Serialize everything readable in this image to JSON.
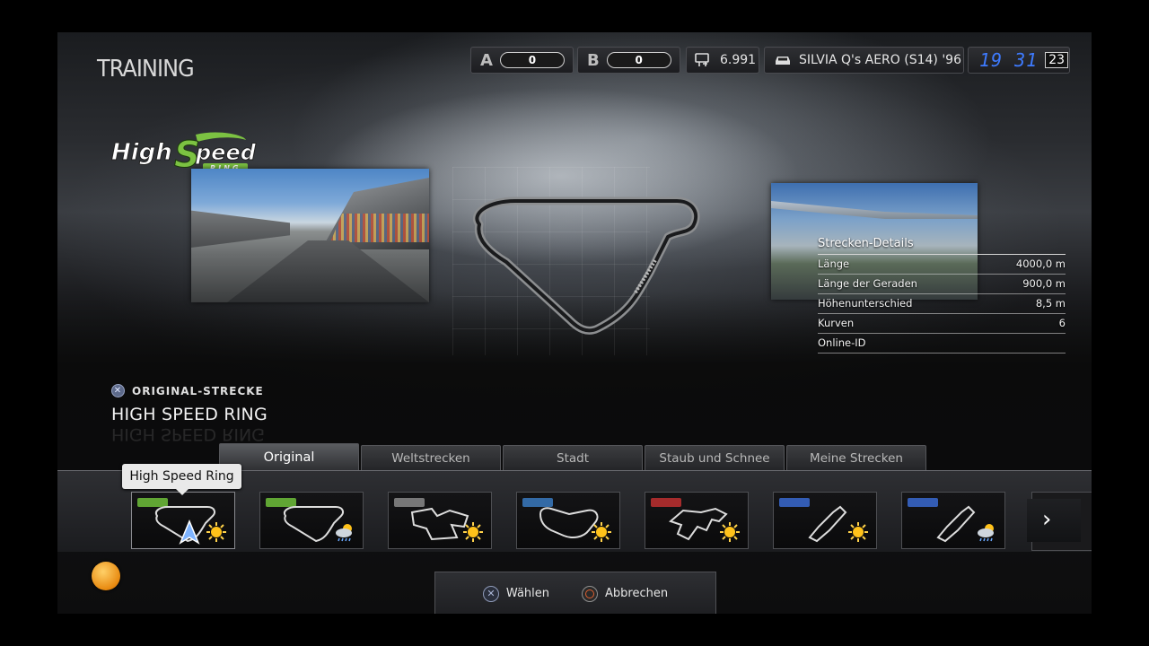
{
  "header": {
    "title": "TRAINING",
    "rating_a": {
      "letter": "A",
      "value": "0"
    },
    "rating_b": {
      "letter": "B",
      "value": "0"
    },
    "credits": "6.991",
    "car": "SILVIA Q's AERO (S14) '96",
    "clock_time": "19 31",
    "clock_day": "23"
  },
  "track": {
    "logo_text": "HIGH SPEED RING",
    "category": "ORIGINAL-STRECKE",
    "name": "HIGH SPEED RING"
  },
  "details": {
    "title": "Strecken-Details",
    "rows": [
      {
        "label": "Länge",
        "value": "4000,0 m"
      },
      {
        "label": "Länge der Geraden",
        "value": "900,0 m"
      },
      {
        "label": "Höhenunterschied",
        "value": "8,5 m"
      },
      {
        "label": "Kurven",
        "value": "6"
      },
      {
        "label": "Online-ID",
        "value": ""
      }
    ]
  },
  "tabs": [
    {
      "label": "Original",
      "active": true
    },
    {
      "label": "Weltstrecken",
      "active": false
    },
    {
      "label": "Stadt",
      "active": false
    },
    {
      "label": "Staub und Schnee",
      "active": false
    },
    {
      "label": "Meine Strecken",
      "active": false
    }
  ],
  "tooltip": "High Speed Ring",
  "cards": [
    {
      "name": "high-speed-ring",
      "weather": "sunny",
      "brand_color": "#6fbf3a"
    },
    {
      "name": "high-speed-ring-rain",
      "weather": "rain",
      "brand_color": "#6fbf3a"
    },
    {
      "name": "trial-mountain",
      "weather": "sunny",
      "brand_color": "#8a8a8a"
    },
    {
      "name": "deep-forest",
      "weather": "sunny",
      "brand_color": "#3a7abf"
    },
    {
      "name": "grand-valley",
      "weather": "sunny",
      "brand_color": "#c03030"
    },
    {
      "name": "special-stage-x",
      "weather": "sunny",
      "brand_color": "#3a6ad0"
    },
    {
      "name": "special-stage-x-rain",
      "weather": "rain",
      "brand_color": "#3a6ad0"
    }
  ],
  "hints": {
    "select": "Wählen",
    "cancel": "Abbrechen"
  },
  "colors": {
    "clock": "#3e7bff",
    "logo_green": "#7cc242"
  }
}
